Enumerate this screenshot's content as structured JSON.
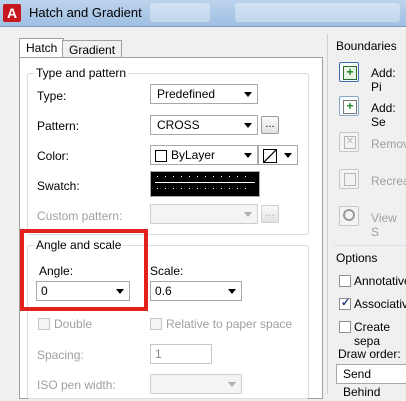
{
  "window": {
    "title": "Hatch and Gradient",
    "app_icon": "A"
  },
  "tabs": [
    {
      "label": "Hatch"
    },
    {
      "label": "Gradient"
    }
  ],
  "type_pattern": {
    "group_title": "Type and pattern",
    "type_label": "Type:",
    "type_value": "Predefined",
    "pattern_label": "Pattern:",
    "pattern_value": "CROSS",
    "color_label": "Color:",
    "color_value": "ByLayer",
    "swatch_label": "Swatch:",
    "custom_pattern_label": "Custom pattern:",
    "browse_label": "..."
  },
  "angle_scale": {
    "group_title": "Angle and scale",
    "angle_label": "Angle:",
    "angle_value": "0",
    "scale_label": "Scale:",
    "scale_value": "0.6",
    "double_label": "Double",
    "relative_label": "Relative to paper space",
    "spacing_label": "Spacing:",
    "spacing_value": "1",
    "iso_label": "ISO pen width:"
  },
  "boundaries": {
    "title": "Boundaries",
    "add_pick": "Add: Pi",
    "add_select": "Add: Se",
    "remove": "Remov",
    "recreate": "Recrea",
    "view": "View S"
  },
  "options": {
    "title": "Options",
    "annotative": "Annotative",
    "associative": "Associative",
    "create_separate": "Create sepa",
    "draw_order_label": "Draw order:",
    "draw_order_value": "Send Behind"
  },
  "colors": {
    "highlight": "#e2201e",
    "titlebar": "#a9c6e8"
  }
}
